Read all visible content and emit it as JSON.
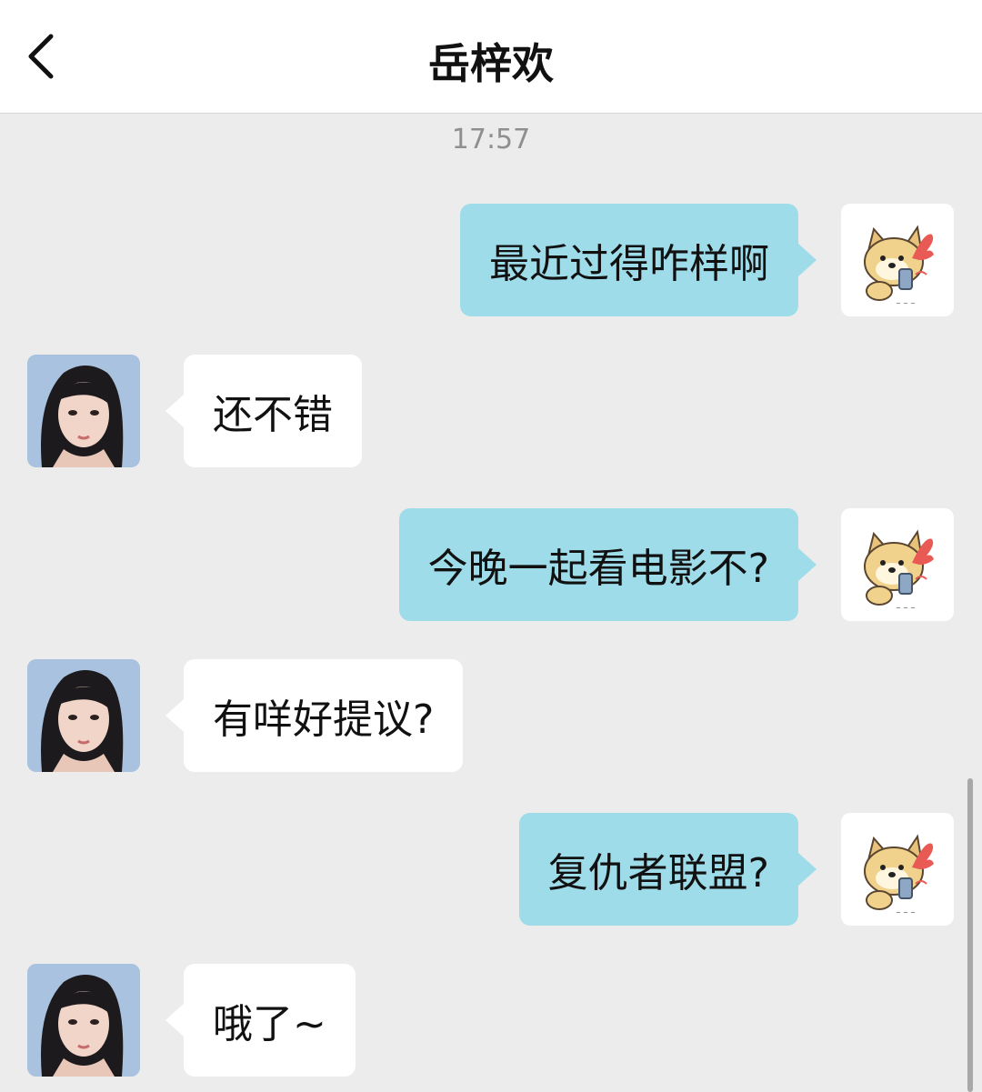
{
  "header": {
    "title": "岳梓欢"
  },
  "timestamp": "17:57",
  "messages": [
    {
      "sender": "me",
      "text": "最近过得咋样啊",
      "avatar_icon": "shiba-dog-sticker-icon"
    },
    {
      "sender": "other",
      "text": "还不错",
      "avatar_icon": "woman-portrait"
    },
    {
      "sender": "me",
      "text": "今晚一起看电影不?",
      "avatar_icon": "shiba-dog-sticker-icon"
    },
    {
      "sender": "other",
      "text": "有咩好提议?",
      "avatar_icon": "woman-portrait"
    },
    {
      "sender": "me",
      "text": "复仇者联盟?",
      "avatar_icon": "shiba-dog-sticker-icon"
    },
    {
      "sender": "other",
      "text": "哦了~",
      "avatar_icon": "woman-portrait"
    }
  ],
  "colors": {
    "background": "#ececec",
    "my_bubble": "#9edcea",
    "other_bubble": "#ffffff",
    "timestamp": "#8f8f8f"
  }
}
